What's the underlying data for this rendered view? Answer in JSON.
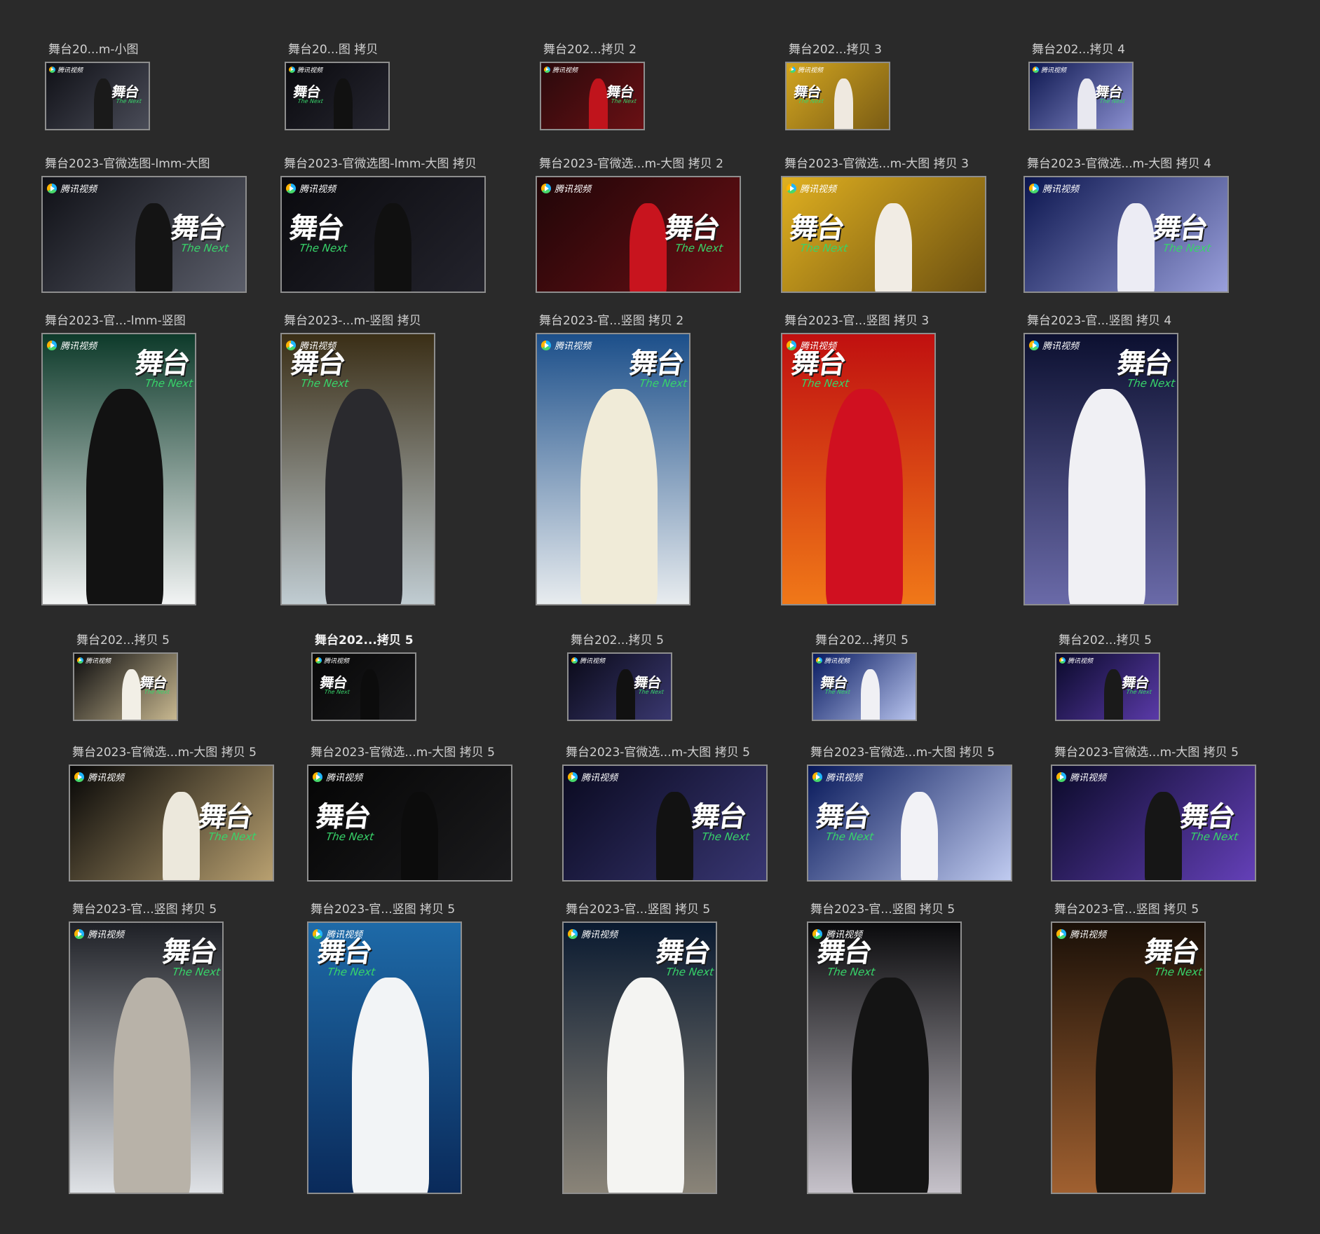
{
  "rows": [
    {
      "kind": "small",
      "items": [
        {
          "label": "舞台20...m-小图",
          "bg": [
            "#0f1016",
            "#4a4c58"
          ],
          "fig": "#1a1a1a"
        },
        {
          "label": "舞台20...图 拷贝",
          "bg": [
            "#0a0a0e",
            "#262630"
          ],
          "fig": "#111"
        },
        {
          "label": "舞台202...拷贝 2",
          "bg": [
            "#2a0a0c",
            "#6a1014"
          ],
          "fig": "#c0141c"
        },
        {
          "label": "舞台202...拷贝 3",
          "bg": [
            "#d2a520",
            "#7a5c14"
          ],
          "fig": "#efe9e0"
        },
        {
          "label": "舞台202...拷贝 4",
          "bg": [
            "#0e1850",
            "#8a8fd0"
          ],
          "fig": "#e8e8f0"
        }
      ]
    },
    {
      "kind": "wide",
      "items": [
        {
          "label": "舞台2023-官微选图-lmm-大图",
          "bg": [
            "#0f1016",
            "#5b5e6a"
          ],
          "fig": "#141414"
        },
        {
          "label": "舞台2023-官微选图-lmm-大图 拷贝",
          "bg": [
            "#0a0a0e",
            "#23232c"
          ],
          "fig": "#101010"
        },
        {
          "label": "舞台2023-官微选...m-大图 拷贝 2",
          "bg": [
            "#200608",
            "#6a0f14"
          ],
          "fig": "#c8141e"
        },
        {
          "label": "舞台2023-官微选...m-大图 拷贝 3",
          "bg": [
            "#e0b020",
            "#6c5010"
          ],
          "fig": "#f1ece4"
        },
        {
          "label": "舞台2023-官微选...m-大图 拷贝 4",
          "bg": [
            "#0b154e",
            "#9aa0dc"
          ],
          "fig": "#ececf4"
        }
      ]
    },
    {
      "kind": "tall",
      "items": [
        {
          "label": "舞台2023-官...-lmm-竖图",
          "bg": [
            "#0d3a2a",
            "#f2f4f4"
          ],
          "fig": "#121212"
        },
        {
          "label": "舞台2023-...m-竖图 拷贝",
          "bg": [
            "#3a2e16",
            "#c0ccd2"
          ],
          "fig": "#2a2a2e"
        },
        {
          "label": "舞台2023-官...竖图 拷贝 2",
          "bg": [
            "#1c4f8a",
            "#e8ecef"
          ],
          "fig": "#f0ebd8"
        },
        {
          "label": "舞台2023-官...竖图 拷贝 3",
          "bg": [
            "#c01010",
            "#f07818"
          ],
          "fig": "#d01020"
        },
        {
          "label": "舞台2023-官...竖图 拷贝 4",
          "bg": [
            "#0c1030",
            "#6a6aa8"
          ],
          "fig": "#f0f0f4"
        }
      ]
    },
    {
      "kind": "small",
      "items": [
        {
          "label": "舞台202...拷贝 5",
          "bg": [
            "#0c0c0e",
            "#c8b890"
          ],
          "fig": "#f2efe6",
          "bold": false
        },
        {
          "label": "舞台202...拷贝 5",
          "bg": [
            "#070707",
            "#1a1a1c"
          ],
          "fig": "#0c0c0c",
          "bold": true
        },
        {
          "label": "舞台202...拷贝 5",
          "bg": [
            "#0a0a18",
            "#3a3870"
          ],
          "fig": "#111",
          "bold": false
        },
        {
          "label": "舞台202...拷贝 5",
          "bg": [
            "#081a60",
            "#b8c4ee"
          ],
          "fig": "#f0f0f4",
          "bold": false
        },
        {
          "label": "舞台202...拷贝 5",
          "bg": [
            "#0a0a2a",
            "#5a3aa8"
          ],
          "fig": "#1a1a1a",
          "bold": false
        }
      ]
    },
    {
      "kind": "wide",
      "items": [
        {
          "label": "舞台2023-官微选...m-大图 拷贝 5",
          "bg": [
            "#060606",
            "#b8a070"
          ],
          "fig": "#ece8dc"
        },
        {
          "label": "舞台2023-官微选...m-大图 拷贝 5",
          "bg": [
            "#050505",
            "#1b1b1d"
          ],
          "fig": "#0c0c0c"
        },
        {
          "label": "舞台2023-官微选...m-大图 拷贝 5",
          "bg": [
            "#0a0a20",
            "#383672"
          ],
          "fig": "#121212"
        },
        {
          "label": "舞台2023-官微选...m-大图 拷贝 5",
          "bg": [
            "#07185a",
            "#c0cbf0"
          ],
          "fig": "#f2f2f6"
        },
        {
          "label": "舞台2023-官微选...m-大图 拷贝 5",
          "bg": [
            "#0a0a28",
            "#6440b8"
          ],
          "fig": "#161616"
        }
      ]
    },
    {
      "kind": "tall",
      "items": [
        {
          "label": "舞台2023-官...竖图 拷贝 5",
          "bg": [
            "#1e2026",
            "#dfe2e6"
          ],
          "fig": "#b8b2a8"
        },
        {
          "label": "舞台2023-官...竖图 拷贝 5",
          "bg": [
            "#1e6aa8",
            "#0a2a5a"
          ],
          "fig": "#f2f4f6"
        },
        {
          "label": "舞台2023-官...竖图 拷贝 5",
          "bg": [
            "#0a1a30",
            "#8a8478"
          ],
          "fig": "#f4f4f2"
        },
        {
          "label": "舞台2023-官...竖图 拷贝 5",
          "bg": [
            "#0a0a0c",
            "#c6c2ca"
          ],
          "fig": "#141414"
        },
        {
          "label": "舞台2023-官...竖图 拷贝 5",
          "bg": [
            "#1a1008",
            "#a06030"
          ],
          "fig": "#18140f"
        }
      ]
    }
  ],
  "thumb_brand": "腾讯视频",
  "thumb_logo": "舞台",
  "thumb_logo_sub": "The Next"
}
